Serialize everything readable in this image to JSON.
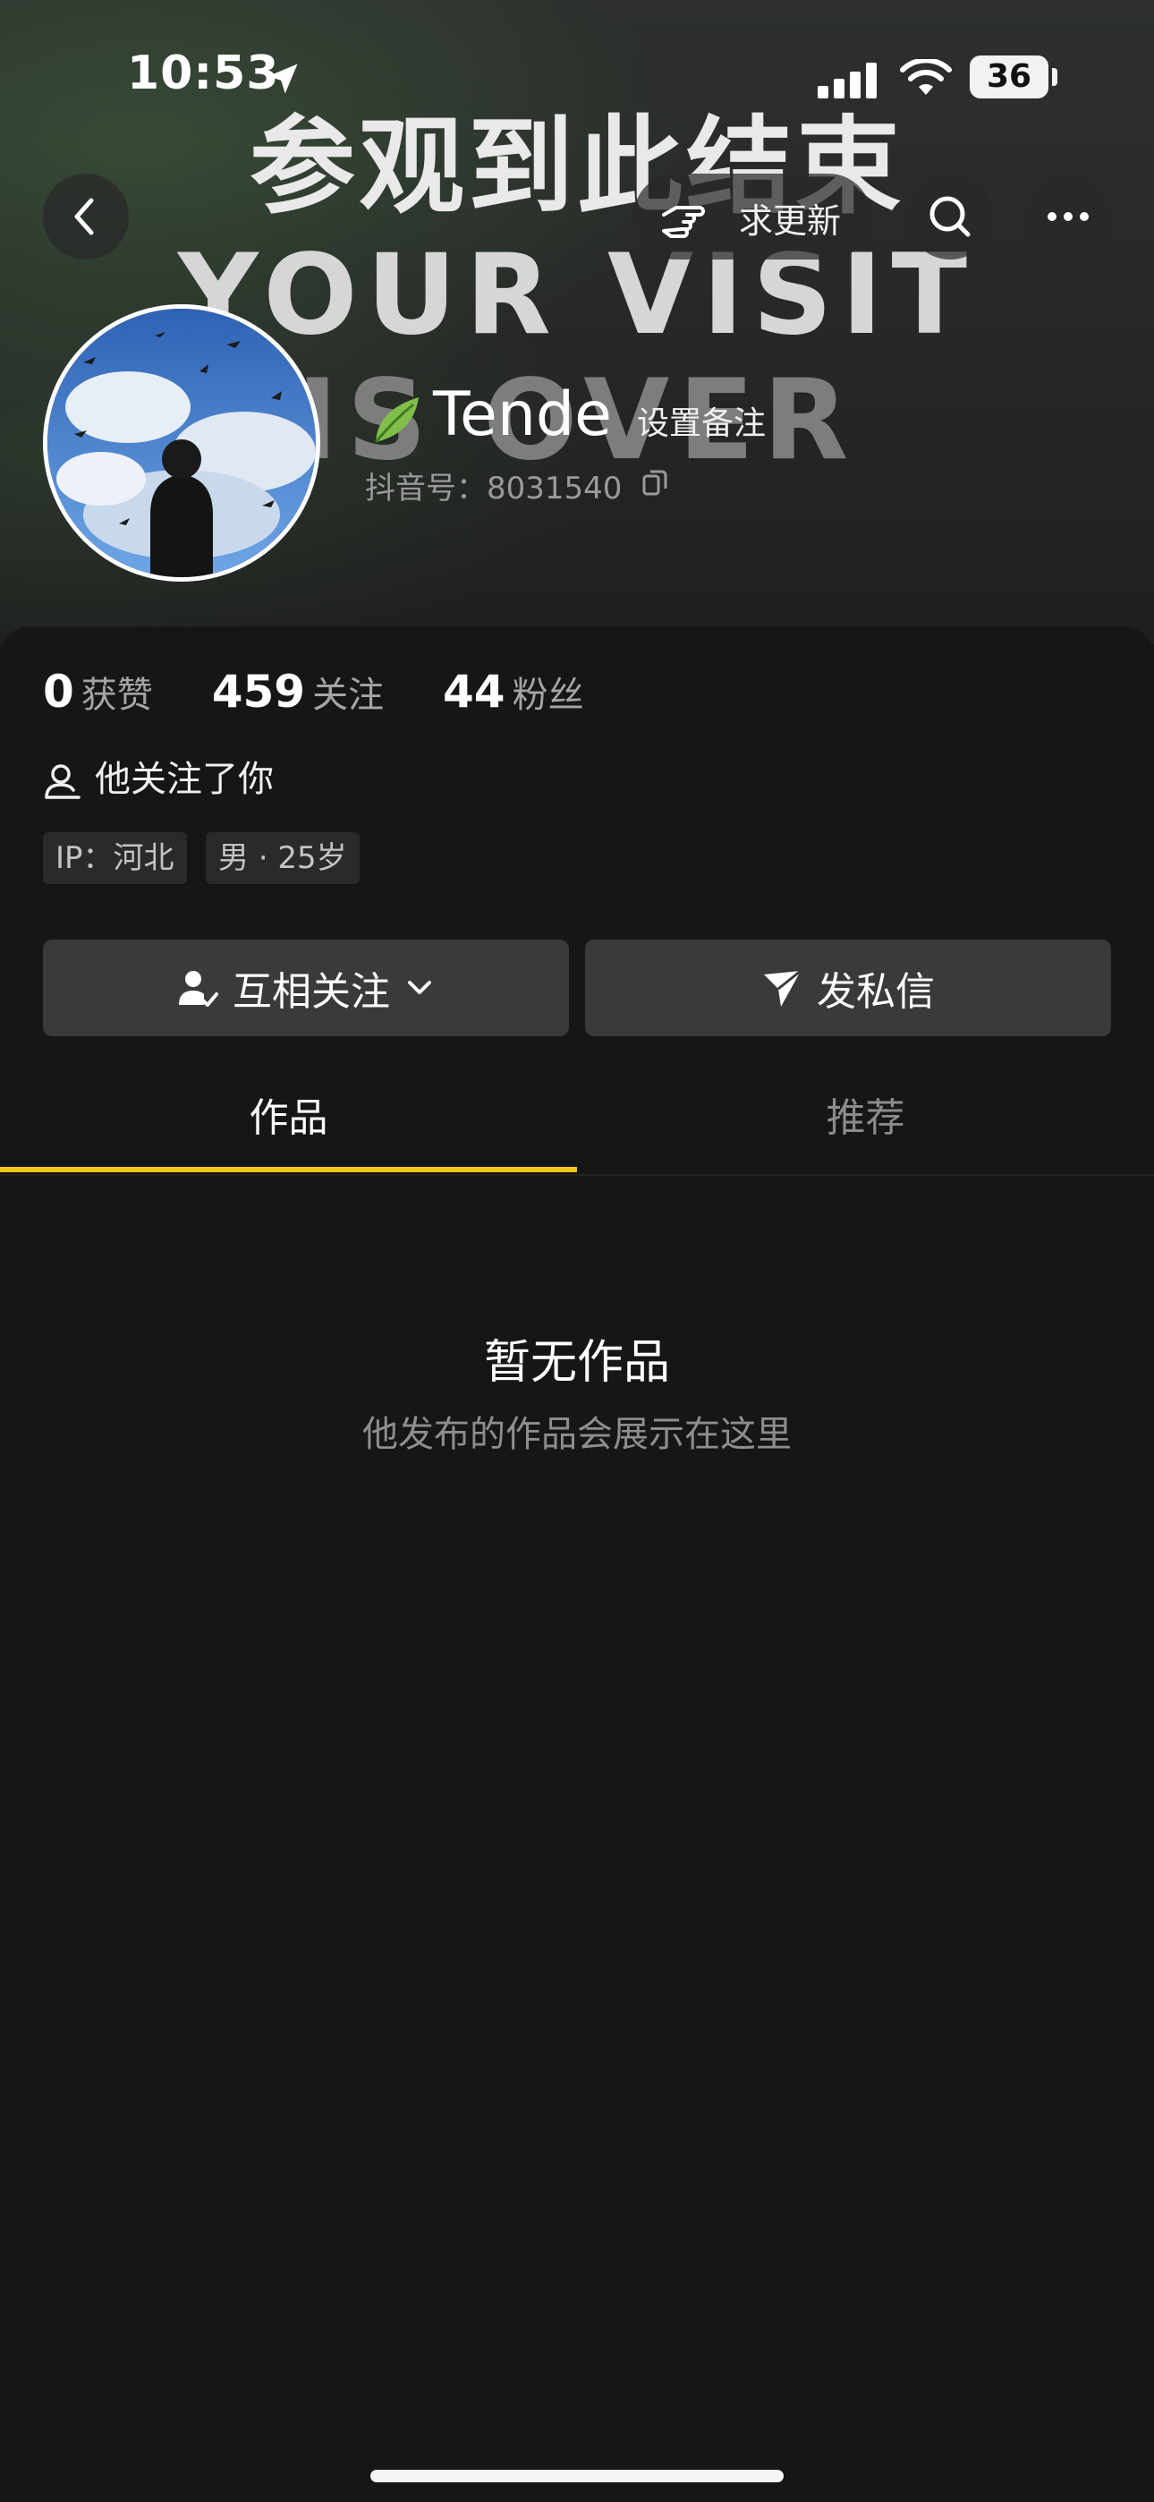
{
  "status_bar": {
    "time": "10:53",
    "battery": "36",
    "icons": [
      "location-arrow-icon",
      "signal-icon",
      "wifi-icon",
      "battery-icon"
    ]
  },
  "banner": {
    "line1": "参观到此结束",
    "line2": "YOUR VISIT",
    "line3": "IS OVER"
  },
  "nav": {
    "update_label": "求更新",
    "icons": [
      "back-icon",
      "pointing-hand-icon",
      "search-icon",
      "more-icon"
    ]
  },
  "profile": {
    "name": "Tende",
    "remark": "设置备注",
    "douyin_id": "抖音号：8031540",
    "icons": [
      "leaf-icon",
      "copy-icon"
    ]
  },
  "stats": [
    {
      "num": "0",
      "label": "获赞"
    },
    {
      "num": "459",
      "label": "关注"
    },
    {
      "num": "44",
      "label": "粉丝"
    }
  ],
  "follow_status": "他关注了你",
  "tags": {
    "ip": "IP：河北",
    "gender_age": "男 · 25岁"
  },
  "actions": {
    "mutual": "互相关注",
    "message": "发私信"
  },
  "tabs": [
    "作品",
    "推荐"
  ],
  "empty": {
    "title": "暂无作品",
    "subtitle": "他发布的作品会展示在这里"
  },
  "colors": {
    "background": "#161616",
    "button": "#3a3a3a",
    "tab_accent": "#f3c81c",
    "muted_text": "#8e8e8e"
  }
}
